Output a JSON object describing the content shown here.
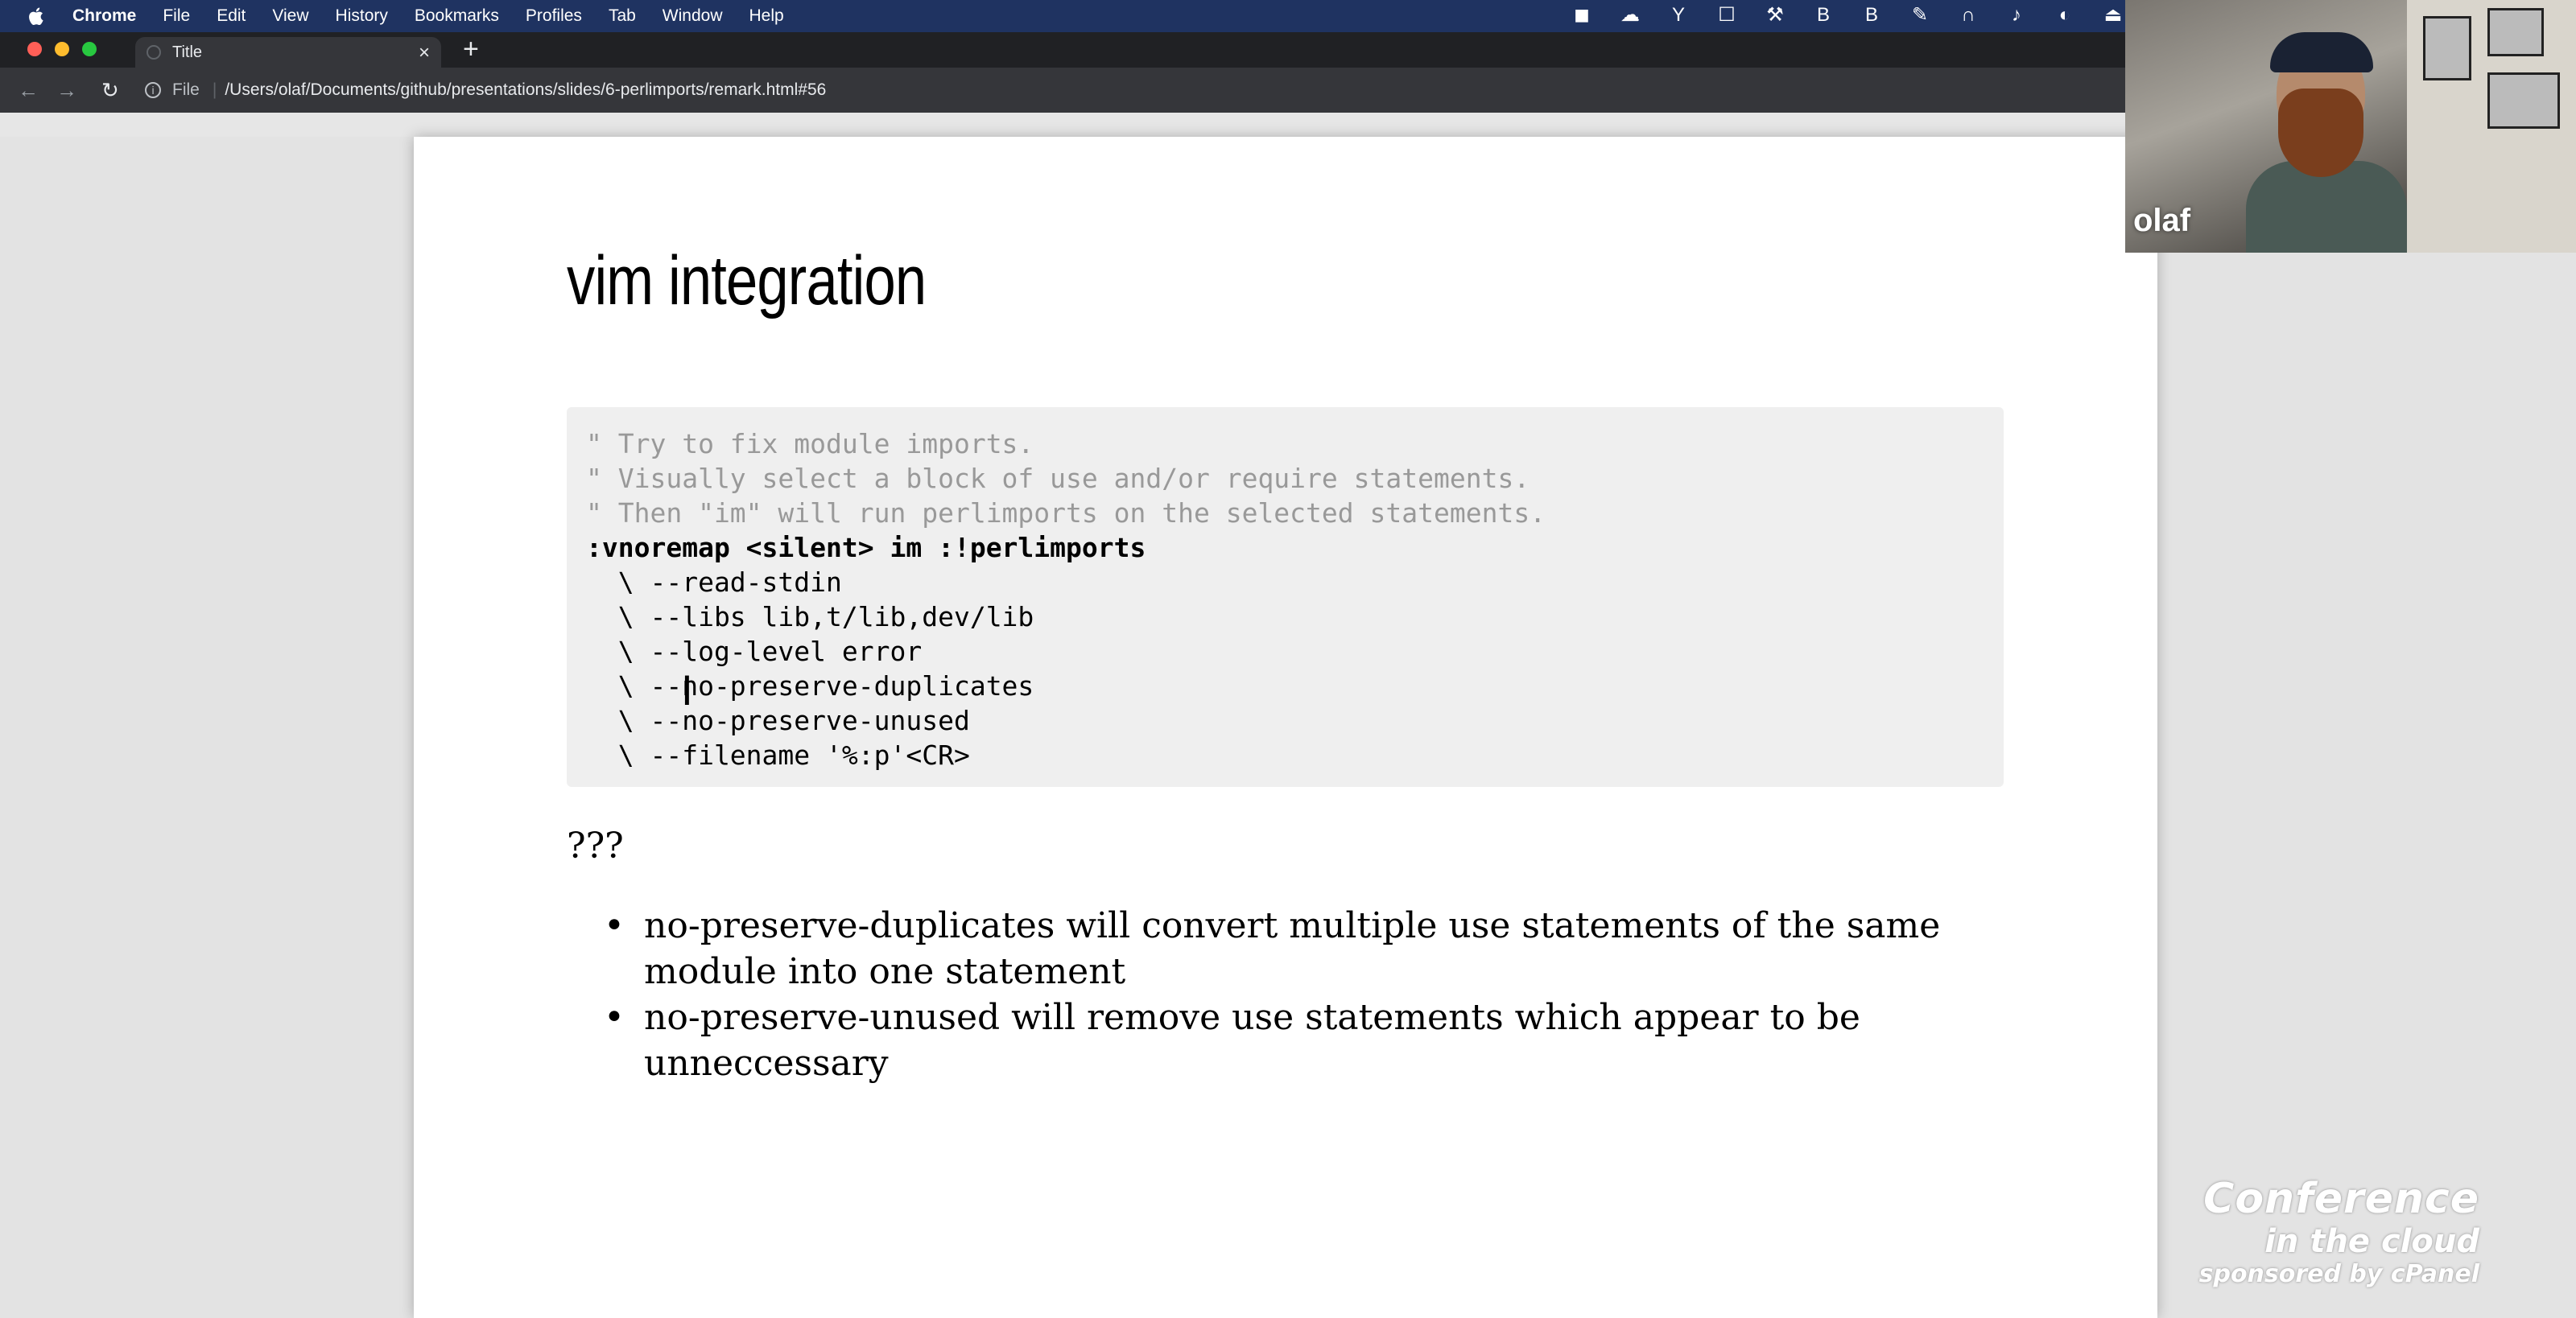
{
  "menubar": {
    "app_name": "Chrome",
    "items": [
      "File",
      "Edit",
      "View",
      "History",
      "Bookmarks",
      "Profiles",
      "Tab",
      "Window",
      "Help"
    ]
  },
  "browser": {
    "tab_title": "Title",
    "new_tab": "+",
    "tab_close": "×",
    "scheme": "File",
    "url": "/Users/olaf/Documents/github/presentations/slides/6-perlimports/remark.html#56"
  },
  "slide": {
    "title": "vim integration",
    "code_lines": [
      "\" Try to fix module imports.",
      "\" Visually select a block of use and/or require statements.",
      "\" Then \"im\" will run perlimports on the selected statements.",
      ":vnoremap <silent> im :!perlimports",
      "  \\ --read-stdin",
      "  \\ --libs lib,t/lib,dev/lib",
      "  \\ --log-level error",
      "  \\ --no-preserve-duplicates",
      "  \\ --no-preserve-unused",
      "  \\ --filename '%:p'<CR>"
    ],
    "question_marks": "???",
    "notes": [
      "no-preserve-duplicates will convert multiple use statements of the same module into one statement",
      "no-preserve-unused will remove use statements which appear to be unneccessary"
    ]
  },
  "webcam": {
    "name": "olaf"
  },
  "watermark": {
    "line1": "Conference",
    "line2": "in the cloud",
    "line3": "sponsored by cPanel"
  }
}
